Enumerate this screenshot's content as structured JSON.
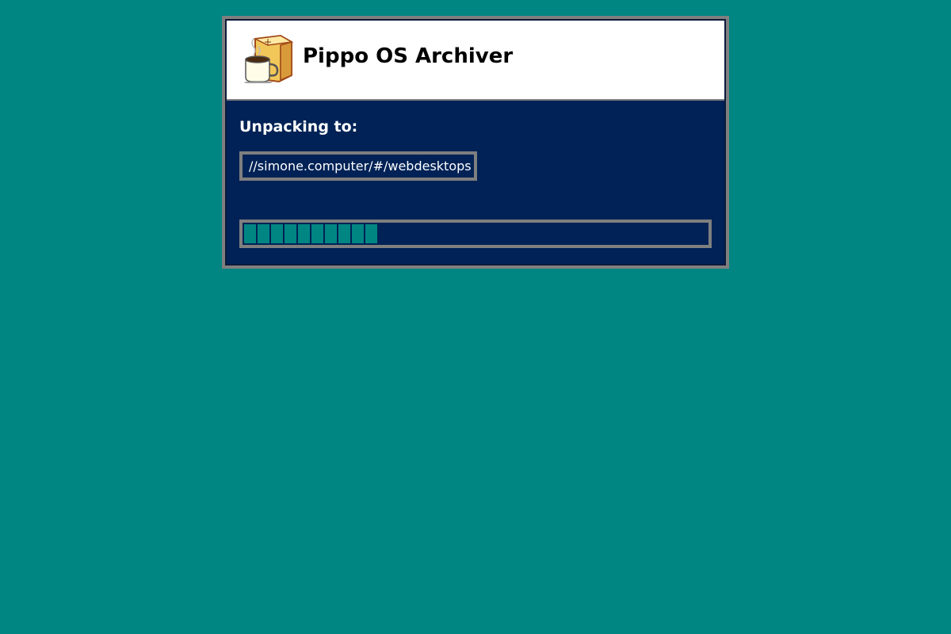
{
  "window": {
    "title": "Pippo OS Archiver",
    "logo_icon": "coffee-cup-box-icon"
  },
  "unpack": {
    "label": "Unpacking to:",
    "path": "//simone.computer/#/webdesktops"
  },
  "progress": {
    "filled_segments": 10,
    "value_fraction": 0.29
  },
  "colors": {
    "desktop_background": "#008682",
    "window_body": "#002256",
    "header_background": "#ffffff",
    "frame": "#7f7f7f",
    "progress_fill": "#008682"
  }
}
